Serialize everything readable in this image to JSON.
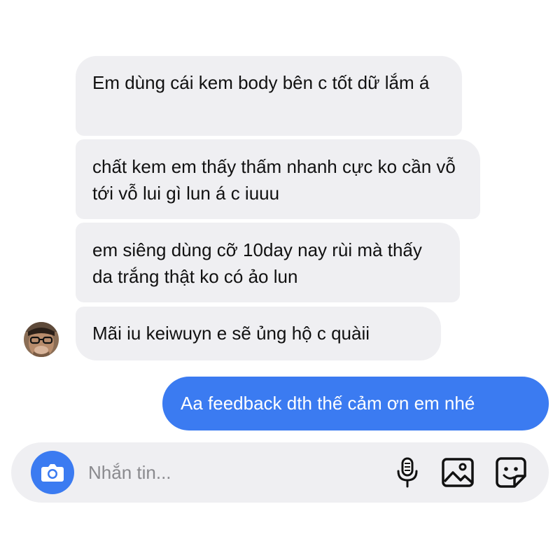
{
  "messages": {
    "incoming": [
      "Em dùng cái kem body bên c tốt dữ lắm á",
      "chất kem em thấy thấm nhanh cực ko cần vỗ tới vỗ lui gì lun á c iuuu",
      "em siêng dùng cỡ 10day nay rùi mà thấy da trắng thật ko có ảo lun",
      "Mãi iu keiwuyn e sẽ ủng hộ c quàii"
    ],
    "outgoing": [
      "Aa feedback dth thế cảm ơn em nhé"
    ]
  },
  "composer": {
    "placeholder": "Nhắn tin...",
    "icons": [
      "camera-icon",
      "microphone-icon",
      "image-icon",
      "sticker-icon"
    ]
  },
  "colors": {
    "incoming_bubble": "#efeff2",
    "outgoing_bubble": "#3b7bf1",
    "accent": "#3b7bf1"
  }
}
